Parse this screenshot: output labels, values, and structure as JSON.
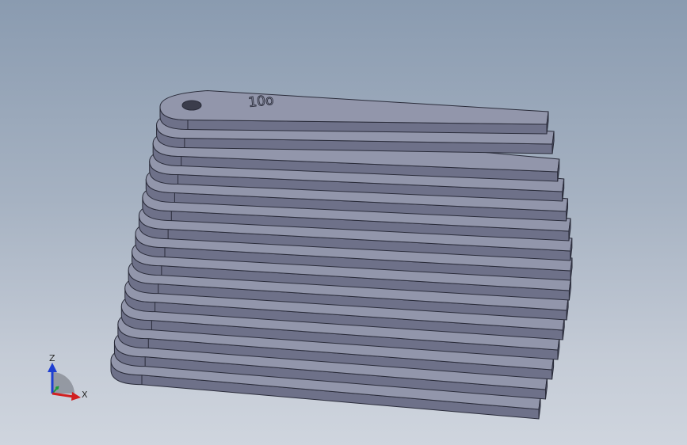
{
  "model": {
    "engraved_text": "10o",
    "fins": 15,
    "colors": {
      "face": "#6e7189",
      "top": "#9296ab",
      "edge": "#2a2c3a",
      "hole": "#3b3d4c"
    }
  },
  "triad": {
    "z_label": "Z",
    "x_label": "X",
    "colors": {
      "z": "#1f3fd1",
      "x": "#d12020",
      "y": "#1f9a3a",
      "quadrant": "#8b8f99"
    }
  },
  "viewport": {
    "background_top": "#8a9bb0",
    "background_bottom": "#cfd5de"
  }
}
